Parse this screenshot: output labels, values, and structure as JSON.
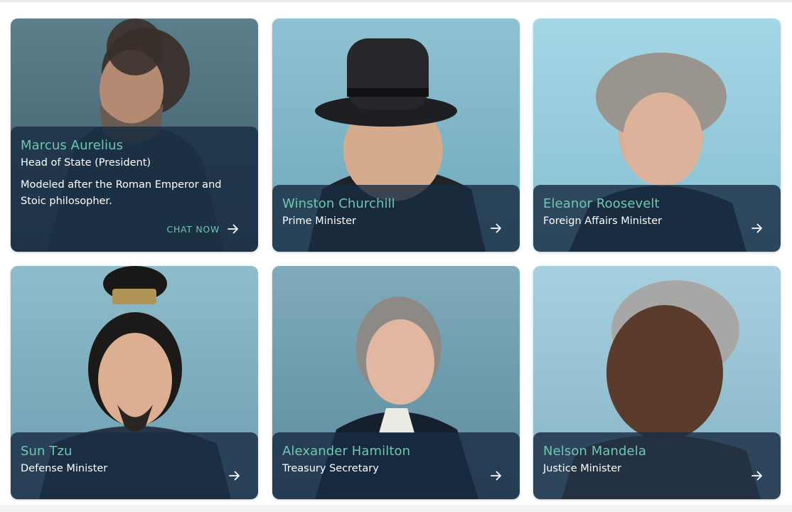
{
  "colors": {
    "accent": "#6fc7b2",
    "overlay": "#182c42",
    "text": "#ffffff"
  },
  "cards": [
    {
      "name": "Marcus Aurelius",
      "role": "Head of State (President)",
      "description": "Modeled after the Roman Emperor and Stoic philosopher.",
      "cta_label": "CHAT NOW",
      "icon": "arrow-right-icon"
    },
    {
      "name": "Winston Churchill",
      "role": "Prime Minister",
      "icon": "arrow-right-icon"
    },
    {
      "name": "Eleanor Roosevelt",
      "role": "Foreign Affairs Minister",
      "icon": "arrow-right-icon"
    },
    {
      "name": "Sun Tzu",
      "role": "Defense Minister",
      "icon": "arrow-right-icon"
    },
    {
      "name": "Alexander Hamilton",
      "role": "Treasury Secretary",
      "icon": "arrow-right-icon"
    },
    {
      "name": "Nelson Mandela",
      "role": "Justice Minister",
      "icon": "arrow-right-icon"
    }
  ]
}
